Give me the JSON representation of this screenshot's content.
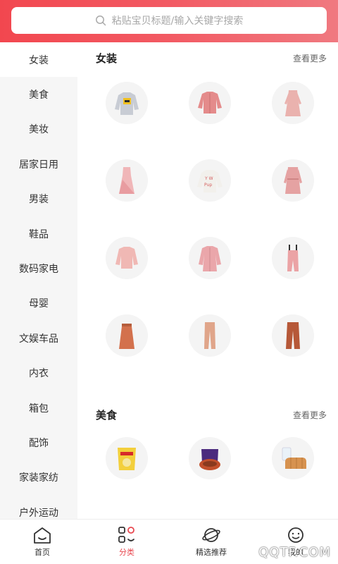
{
  "search": {
    "placeholder": "粘贴宝贝标题/输入关键字搜索"
  },
  "sidebar": {
    "items": [
      {
        "label": "女装",
        "active": true
      },
      {
        "label": "美食"
      },
      {
        "label": "美妆"
      },
      {
        "label": "居家日用"
      },
      {
        "label": "男装"
      },
      {
        "label": "鞋品"
      },
      {
        "label": "数码家电"
      },
      {
        "label": "母婴"
      },
      {
        "label": "文娱车品"
      },
      {
        "label": "内衣"
      },
      {
        "label": "箱包"
      },
      {
        "label": "配饰"
      },
      {
        "label": "家装家纺"
      },
      {
        "label": "户外运动"
      }
    ]
  },
  "sections": [
    {
      "title": "女装",
      "more": "查看更多",
      "items": [
        "graphic-sweatshirt",
        "pink-jacket",
        "pink-dress",
        "pink-pleated-dress",
        "printed-sweater",
        "pink-trench-dress",
        "ruffle-blouse",
        "pink-coat",
        "pink-overalls",
        "rust-skirt",
        "beige-trousers",
        "rust-trousers"
      ]
    },
    {
      "title": "美食",
      "more": "查看更多",
      "items": [
        "potato-chips",
        "snack-bag",
        "bread-and-milk"
      ]
    }
  ],
  "tabbar": {
    "tabs": [
      {
        "label": "首页",
        "icon": "home-icon"
      },
      {
        "label": "分类",
        "icon": "category-icon",
        "active": true
      },
      {
        "label": "精选推荐",
        "icon": "planet-icon"
      },
      {
        "label": "我的",
        "icon": "smile-icon"
      }
    ]
  },
  "watermark": "QQTF.COM",
  "colors": {
    "accent": "#e8474f",
    "header_start": "#f2474f",
    "header_end": "#f07980"
  }
}
